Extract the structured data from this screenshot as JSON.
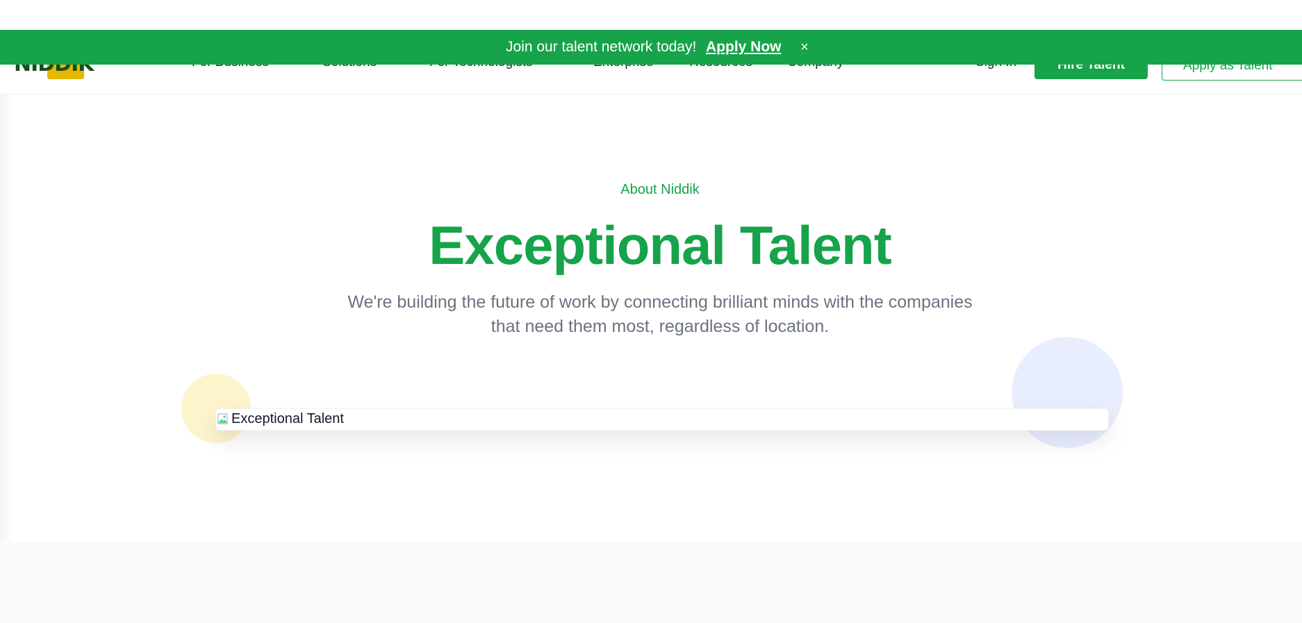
{
  "banner": {
    "text": "Join our talent network today!",
    "link_label": "Apply Now",
    "close_glyph": "×",
    "close_icon": "close-icon",
    "background_color": "#16a34a"
  },
  "nav": {
    "logo_text": "NIDDIK",
    "links": [
      "For Business",
      "Solutions",
      "For Technologists",
      "Enterprise",
      "Resources",
      "Company"
    ],
    "sign_in": "Sign In",
    "hire_talent": "Hire Talent",
    "apply_as_talent": "Apply as Talent"
  },
  "hero": {
    "eyebrow": "About Niddik",
    "title": "Exceptional Talent",
    "subtitle": "We're building the future of work by connecting brilliant minds with the companies that need them most, regardless of location.",
    "image_alt": "Exceptional Talent",
    "image_icon": "broken-image-icon"
  },
  "colors": {
    "accent": "#16a34a",
    "text_muted": "#6b7280",
    "circle_yellow": "#fef3c7",
    "circle_blue": "#e0e7ff",
    "logo_yellow": "#e6b800",
    "logo_dark_green": "#1a4d1a"
  }
}
